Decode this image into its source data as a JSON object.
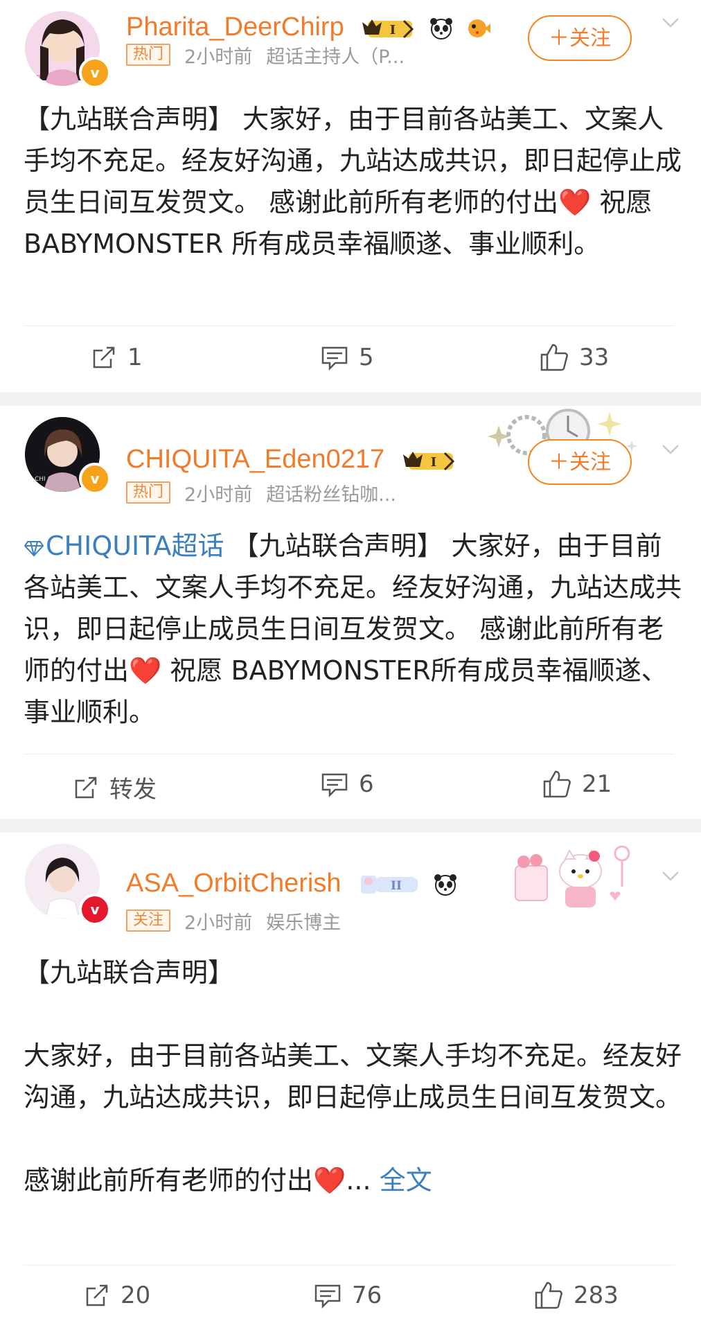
{
  "posts": [
    {
      "username": "Pharita_DeerChirp",
      "tag": "热门",
      "time": "2小时前",
      "source": "超话主持人（P...",
      "follow_label": "＋关注",
      "text_a": "【九站联合声明】 大家好，由于目前各站美工、文案人手均不充足。经友好沟通，九站达成共识，即日起停止成员生日间互发贺文。 感谢此前所有老师的付出",
      "heart": "❤️",
      "text_b": " 祝愿 BABYMONSTER 所有成员幸福顺遂、事业顺利。",
      "repost": "1",
      "comments": "5",
      "likes": "33",
      "badge_level": "I"
    },
    {
      "username": "CHIQUITA_Eden0217",
      "tag": "热门",
      "time": "2小时前",
      "source": "超话粉丝钻咖...",
      "follow_label": "＋关注",
      "topic_link": "CHIQUITA超话",
      "text_a": " 【九站联合声明】 大家好，由于目前各站美工、文案人手均不充足。经友好沟通，九站达成共识，即日起停止成员生日间互发贺文。 感谢此前所有老师的付出",
      "heart": "❤️",
      "text_b": " 祝愿 BABYMONSTER所有成员幸福顺遂、事业顺利。",
      "repost": "转发",
      "comments": "6",
      "likes": "21",
      "badge_level": "I"
    },
    {
      "username": "ASA_OrbitCherish",
      "tag": "关注",
      "time": "2小时前",
      "source": "娱乐博主",
      "para1": "【九站联合声明】",
      "para2": "大家好，由于目前各站美工、文案人手均不充足。经友好沟通，九站达成共识，即日起停止成员生日间互发贺文。",
      "para3": "感谢此前所有老师的付出",
      "heart": "❤️",
      "ellipsis": "...",
      "full_text_link": "全文",
      "repost": "20",
      "comments": "76",
      "likes": "283",
      "badge_level": "II"
    }
  ],
  "colors": {
    "username": "#f07b2a",
    "link": "#3a7fbf",
    "meta": "#9a9a9a",
    "background": "#f2f2f2"
  }
}
